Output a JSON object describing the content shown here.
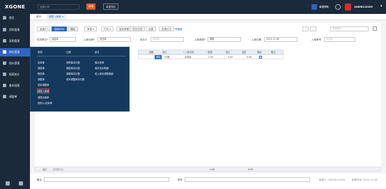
{
  "top": {
    "logo": "XGONE",
    "selector": "全部公司",
    "btn1": "新增",
    "btn2": "单据导航",
    "right_text": "单据帮助",
    "user": "18408110205"
  },
  "sidebar": {
    "items": [
      {
        "label": "首页"
      },
      {
        "label": "资料管理"
      },
      {
        "label": "采购管理"
      },
      {
        "label": "库存管理"
      },
      {
        "label": "报价管理"
      },
      {
        "label": "报表统计"
      },
      {
        "label": "基本档案"
      },
      {
        "label": "调整单"
      }
    ],
    "active_index": 3
  },
  "tabs": {
    "home": "首页",
    "current": "调拨入库单",
    "close": "×"
  },
  "toolbar": {
    "buttons": [
      "新建(F2)",
      "保存(F6)",
      "删除",
      "审核",
      "打印",
      "复制单据",
      "设置",
      "查看日志",
      "快捷键"
    ],
    "doc_no_placeholder": "单据编号"
  },
  "form": {
    "company_label": "供货单位*",
    "company_value": "请选择",
    "warehouse_label": "入库仓库*",
    "warehouse_value": "总仓库",
    "handler_label": "经手人",
    "handler_value": "请选择",
    "in_type_label": "入库类型*",
    "in_type_value": "调拨",
    "date_label": "入库日期",
    "date_value": "2023-11-08",
    "remark_label": "入库单号",
    "remark_value": "请选择"
  },
  "grid": {
    "headers": [
      "编码",
      "名称",
      "规格",
      "单位",
      "* 入库仓库",
      "* 数量",
      "单价",
      "金额",
      "赠品",
      "备注"
    ],
    "row": {
      "tag": "添加",
      "unit": "只/瓶",
      "warehouse": "总仓库",
      "qty": "1.00",
      "price": "0.00",
      "amount": "0.00"
    }
  },
  "menu": {
    "col1_title": "采购",
    "col2_title": "记账",
    "col3_title": "统计",
    "col1": [
      "出库单",
      "调拨单",
      "报损单",
      "调整单",
      "成本调整单",
      "调拨入库单",
      "调拨出库单",
      "其他入/出库单"
    ],
    "col2": [
      "采购库存记账",
      "调拨库存记账",
      "调整库存记账",
      "成本调整库存记账"
    ],
    "col3": [
      "库存查询",
      "库存流水明细",
      "收入库存调整明细"
    ],
    "highlight": "调拨入库单"
  },
  "footer": {
    "total_label": "合计",
    "total_sub": "总金额(元)",
    "qty_total": "1.00",
    "amount_total": "0.00",
    "bottom_left_label": "备注",
    "bottom_mid_label": "附件",
    "creator": "制单人: 18408110205",
    "create_time": "制单时间: 2023-11-08"
  },
  "colors": {
    "nav_bg": "#1b2a3a",
    "active": "#2e66c0",
    "accent_orange": "#e8582a",
    "menu_bg": "#15385d"
  }
}
